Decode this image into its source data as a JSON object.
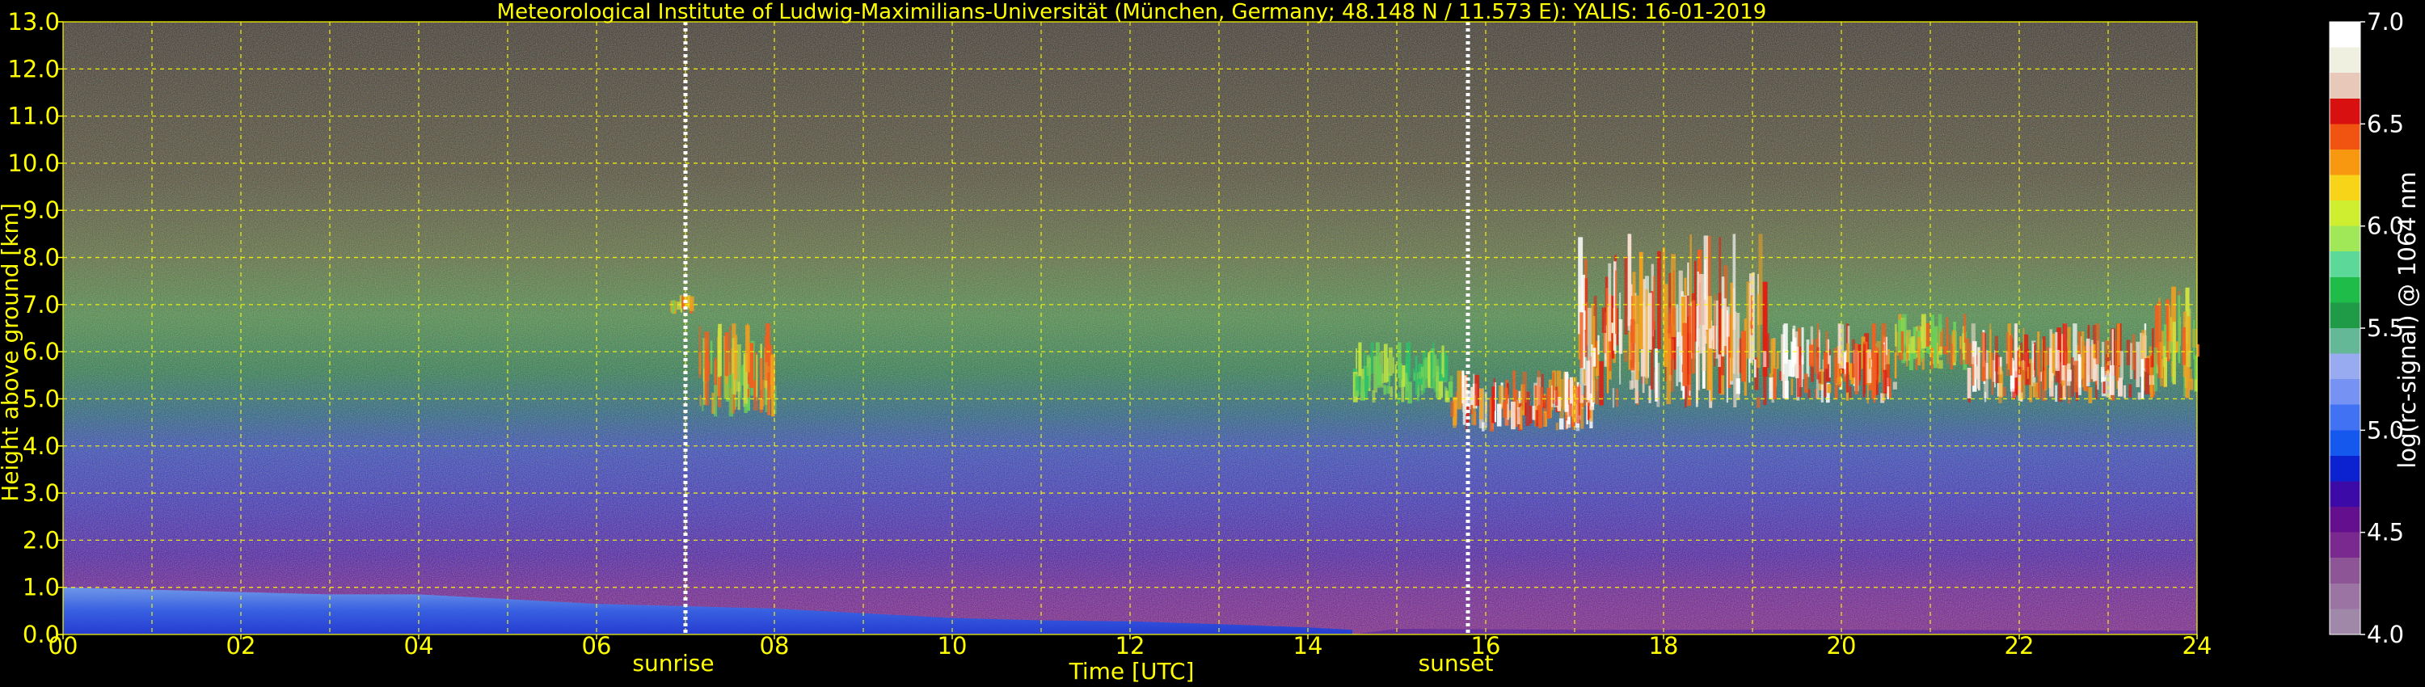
{
  "chart_data": {
    "type": "heatmap",
    "title": "Meteorological Institute of Ludwig-Maximilians-Universität (München, Germany; 48.148 N / 11.573 E):    YALIS: 16-01-2019",
    "xlabel": "Time [UTC]",
    "ylabel": "Height above ground [km]",
    "xlim": [
      0,
      24
    ],
    "ylim": [
      0,
      13
    ],
    "x_ticks": [
      "00",
      "02",
      "04",
      "06",
      "08",
      "10",
      "12",
      "14",
      "16",
      "18",
      "20",
      "22",
      "24"
    ],
    "y_ticks": [
      "0.0",
      "1.0",
      "2.0",
      "3.0",
      "4.0",
      "5.0",
      "6.0",
      "7.0",
      "8.0",
      "9.0",
      "10.0",
      "11.0",
      "12.0",
      "13.0"
    ],
    "grid": true,
    "grid_color": "#ffff00",
    "text_color": "#ffff00",
    "colorbar": {
      "label": "log(rc-signal) @ 1064 nm",
      "range": [
        4.0,
        7.0
      ],
      "ticks": [
        "4.0",
        "4.5",
        "5.0",
        "5.5",
        "6.0",
        "6.5",
        "7.0"
      ],
      "colors": [
        "#a088a8",
        "#9c74a4",
        "#8e5596",
        "#7a2a8e",
        "#64108e",
        "#3c0aa6",
        "#0c22d0",
        "#1458ee",
        "#4272f4",
        "#7692f2",
        "#98aaf0",
        "#64b898",
        "#1f9a46",
        "#1fbc4a",
        "#5cd898",
        "#a0e858",
        "#d0ee30",
        "#f8d418",
        "#f89810",
        "#f05410",
        "#d81010",
        "#e8c8b8",
        "#f0f0e0",
        "#ffffff"
      ]
    },
    "annotations": [
      {
        "text": "sunrise",
        "x": 7.0
      },
      {
        "text": "sunset",
        "x": 15.8
      }
    ],
    "cloud_patches": [
      {
        "t0": 7.15,
        "t1": 8.0,
        "h0": 4.6,
        "h1": 6.6,
        "level": "medium"
      },
      {
        "t0": 6.8,
        "t1": 7.05,
        "h0": 6.8,
        "h1": 7.2,
        "level": "medium"
      },
      {
        "t0": 14.5,
        "t1": 15.6,
        "h0": 4.9,
        "h1": 6.2,
        "level": "low"
      },
      {
        "t0": 15.6,
        "t1": 17.2,
        "h0": 4.3,
        "h1": 5.6,
        "level": "high"
      },
      {
        "t0": 17.0,
        "t1": 19.2,
        "h0": 4.8,
        "h1": 8.5,
        "level": "high"
      },
      {
        "t0": 19.2,
        "t1": 20.6,
        "h0": 4.9,
        "h1": 6.6,
        "level": "high"
      },
      {
        "t0": 20.6,
        "t1": 21.4,
        "h0": 5.6,
        "h1": 6.8,
        "level": "medium"
      },
      {
        "t0": 21.4,
        "t1": 23.5,
        "h0": 4.9,
        "h1": 6.6,
        "level": "high"
      },
      {
        "t0": 23.5,
        "t1": 24.0,
        "h0": 5.0,
        "h1": 7.5,
        "level": "medium"
      }
    ]
  }
}
